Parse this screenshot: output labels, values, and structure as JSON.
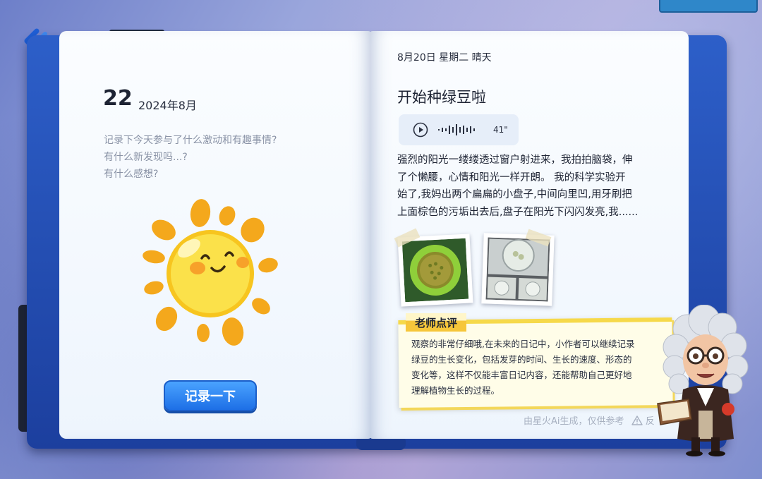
{
  "left_page": {
    "day": "22",
    "month": "2024年8月",
    "prompt_lines": [
      "记录下今天参与了什么激动和有趣事情?",
      "有什么新发现吗...?",
      "有什么感想?"
    ],
    "record_button": "记录一下",
    "illustration_icon": "smiling-sun-icon"
  },
  "right_page": {
    "meta": "8月20日  星期二  晴天",
    "title": "开始种绿豆啦",
    "audio": {
      "duration": "41\""
    },
    "body_lines": [
      "强烈的阳光一缕缕透过窗户射进来，我拍拍脑袋，伸",
      "了个懒腰，心情和阳光一样开朗。 我的科学实验开",
      "始了,我妈出两个扁扁的小盘子,中间向里凹,用牙刷把",
      "上面棕色的污垢出去后,盘子在阳光下闪闪发亮,我......"
    ],
    "comment": {
      "tag": "老师点评",
      "lines": [
        "观察的非常仔细哦,在未来的日记中，小作者可以继续记录",
        "绿豆的生长变化，包括发芽的时间、生长的速度、形态的",
        "变化等，这样不仅能丰富日记内容，还能帮助自己更好地",
        "理解植物生长的过程。"
      ]
    },
    "ai_note": "由星火Ai生成，仅供参考",
    "feedback_partial": "反"
  },
  "colors": {
    "book_blue": "#2d5fc9",
    "button_blue": "#1d6fe6",
    "tag_yellow": "#f6c63a",
    "sun_yellow": "#f7c51f"
  }
}
